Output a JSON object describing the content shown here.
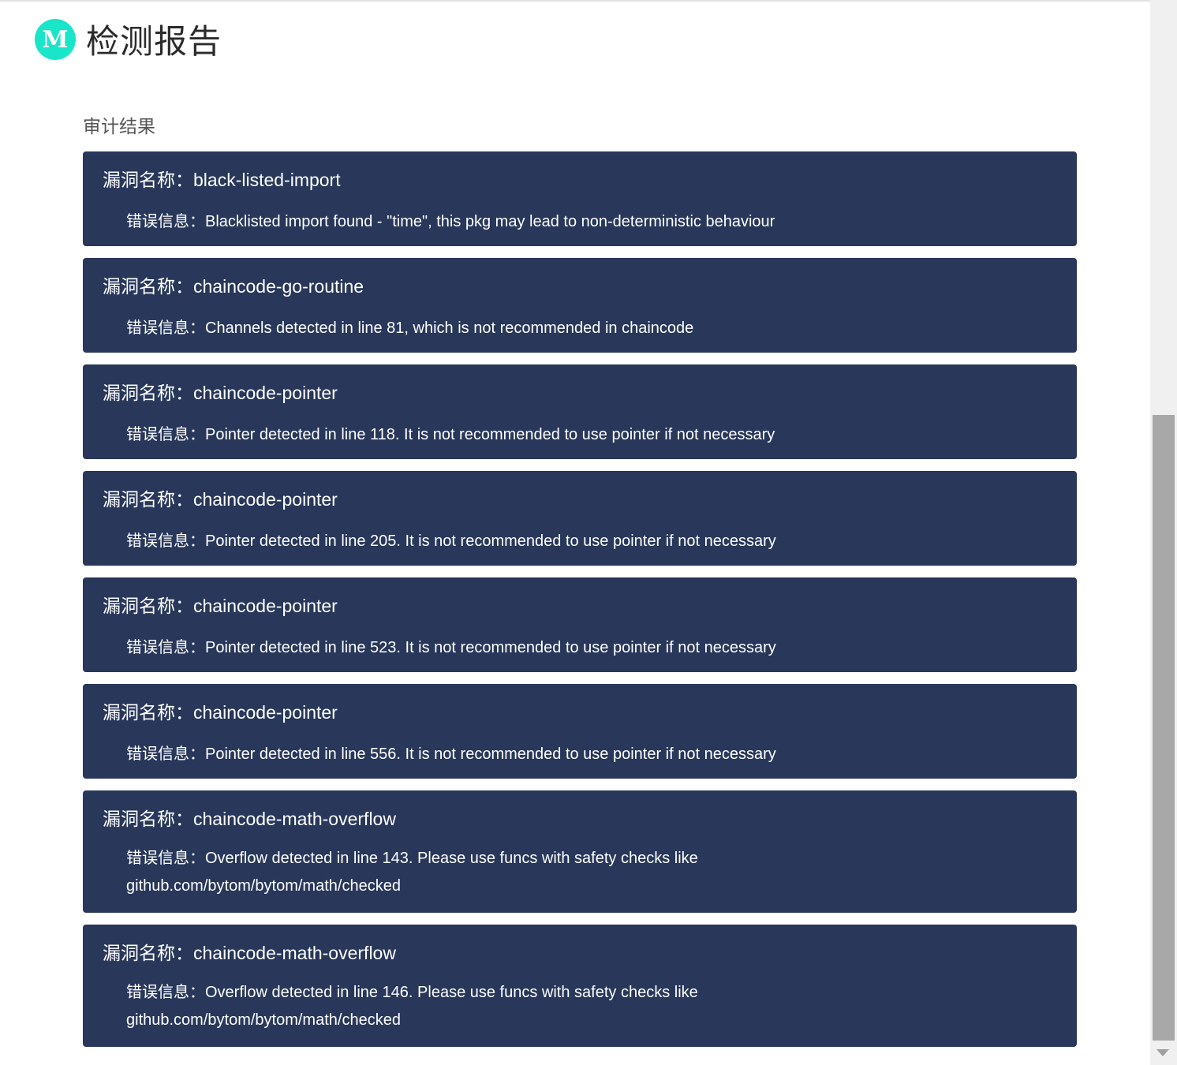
{
  "header": {
    "logo_letter": "M",
    "title": "检测报告"
  },
  "section": {
    "label": "审计结果"
  },
  "labels": {
    "vuln_name": "漏洞名称：",
    "error_info": "错误信息："
  },
  "results": [
    {
      "name": "black-listed-import",
      "message": "Blacklisted import found - \"time\", this pkg may lead to non-deterministic behaviour"
    },
    {
      "name": "chaincode-go-routine",
      "message": "Channels detected in line 81, which is not recommended in chaincode"
    },
    {
      "name": "chaincode-pointer",
      "message": "Pointer detected in line 118. It is not recommended to use pointer if not necessary"
    },
    {
      "name": "chaincode-pointer",
      "message": "Pointer detected in line 205. It is not recommended to use pointer if not necessary"
    },
    {
      "name": "chaincode-pointer",
      "message": "Pointer detected in line 523. It is not recommended to use pointer if not necessary"
    },
    {
      "name": "chaincode-pointer",
      "message": "Pointer detected in line 556. It is not recommended to use pointer if not necessary"
    },
    {
      "name": "chaincode-math-overflow",
      "message": "Overflow detected in line 143. Please use funcs with safety checks like github.com/bytom/bytom/math/checked"
    },
    {
      "name": "chaincode-math-overflow",
      "message": "Overflow detected in line 146. Please use funcs with safety checks like github.com/bytom/bytom/math/checked"
    }
  ]
}
